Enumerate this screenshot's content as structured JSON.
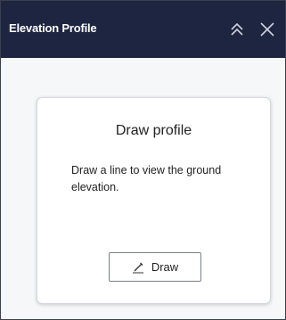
{
  "panel": {
    "title": "Elevation Profile",
    "collapse_icon": "double-chevron-up-icon",
    "close_icon": "close-icon"
  },
  "card": {
    "title": "Draw profile",
    "description": "Draw a line to view the ground elevation.",
    "draw_button_label": "Draw",
    "draw_button_icon": "pencil-icon"
  },
  "colors": {
    "header_bg": "#1e2540",
    "panel_bg": "#f6f7f9",
    "card_bg": "#ffffff"
  }
}
